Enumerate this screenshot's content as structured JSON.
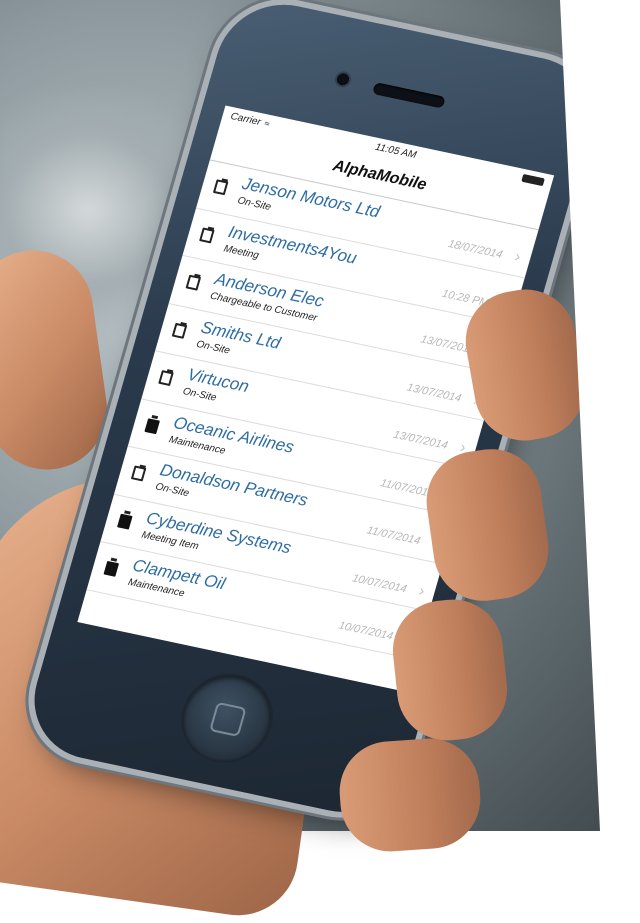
{
  "status": {
    "carrier": "Carrier",
    "wifi_icon": "wifi-icon",
    "time": "11:05 AM",
    "battery_icon": "battery-icon"
  },
  "nav": {
    "title": "AlphaMobile"
  },
  "jobs": [
    {
      "title": "Jenson Motors Ltd",
      "type": "On-Site",
      "date": "18/07/2014",
      "icon": "clipboard-outline-icon"
    },
    {
      "title": "Investments4You",
      "type": "Meeting",
      "date": "10:28 PM",
      "icon": "clipboard-outline-icon"
    },
    {
      "title": "Anderson Elec",
      "type": "Chargeable to Customer",
      "date": "13/07/2014",
      "icon": "clipboard-outline-icon"
    },
    {
      "title": "Smiths Ltd",
      "type": "On-Site",
      "date": "13/07/2014",
      "icon": "clipboard-outline-icon"
    },
    {
      "title": "Virtucon",
      "type": "On-Site",
      "date": "13/07/2014",
      "icon": "clipboard-outline-icon"
    },
    {
      "title": "Oceanic Airlines",
      "type": "Maintenance",
      "date": "11/07/2014",
      "icon": "clipboard-solid-icon"
    },
    {
      "title": "Donaldson Partners",
      "type": "On-Site",
      "date": "11/07/2014",
      "icon": "clipboard-outline-icon"
    },
    {
      "title": "Cyberdine Systems",
      "type": "Meeting Item",
      "date": "10/07/2014",
      "icon": "clipboard-solid-icon"
    },
    {
      "title": "Clampett Oil",
      "type": "Maintenance",
      "date": "10/07/2014",
      "icon": "clipboard-solid-icon"
    }
  ],
  "colors": {
    "title_blue": "#2e6da4",
    "date_grey": "#b7b7b7",
    "phone_body": "#2a3a4c"
  }
}
